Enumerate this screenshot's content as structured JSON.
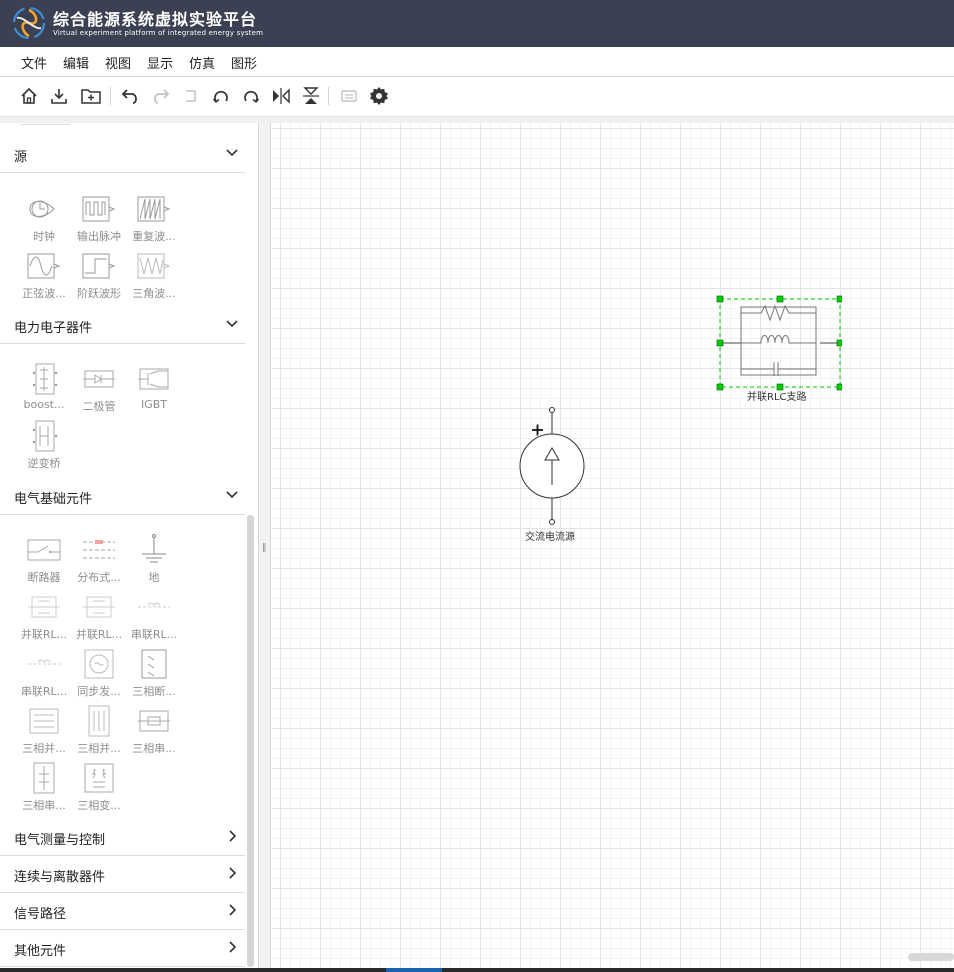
{
  "header": {
    "title": "综合能源系统虚拟实验平台",
    "subtitle": "Virtual experiment platform of integrated energy system",
    "bg_color": "#3b4153"
  },
  "menu": [
    "文件",
    "编辑",
    "视图",
    "显示",
    "仿真",
    "图形"
  ],
  "toolbar": {
    "buttons": [
      "home-icon",
      "download-icon",
      "new-folder-icon",
      "undo-icon",
      "redo-icon",
      "connector-icon",
      "rotate-left-icon",
      "rotate-right-icon",
      "flip-horizontal-icon",
      "flip-vertical-icon",
      "group-icon",
      "settings-icon"
    ]
  },
  "sidebar": {
    "categories": [
      {
        "label": "源",
        "expanded": true,
        "items": [
          "时钟",
          "输出脉冲",
          "重复波...",
          "正弦波...",
          "阶跃波形",
          "三角波..."
        ]
      },
      {
        "label": "电力电子器件",
        "expanded": true,
        "items": [
          "boost...",
          "二极管",
          "IGBT",
          "逆变桥"
        ]
      },
      {
        "label": "电气基础元件",
        "expanded": true,
        "items": [
          "断路器",
          "分布式...",
          "地",
          "并联RL...",
          "并联RL...",
          "串联RL...",
          "串联RL...",
          "同步发...",
          "三相断...",
          "三相并...",
          "三相并...",
          "三相串...",
          "三相串...",
          "三相变..."
        ]
      },
      {
        "label": "电气测量与控制",
        "expanded": false
      },
      {
        "label": "连续与离散器件",
        "expanded": false
      },
      {
        "label": "信号路径",
        "expanded": false
      },
      {
        "label": "其他元件",
        "expanded": false
      }
    ]
  },
  "canvas": {
    "components": [
      {
        "label": "并联RLC支路",
        "selected": true
      },
      {
        "label": "交流电流源",
        "selected": false
      }
    ],
    "selection_color": "#00cc00"
  }
}
